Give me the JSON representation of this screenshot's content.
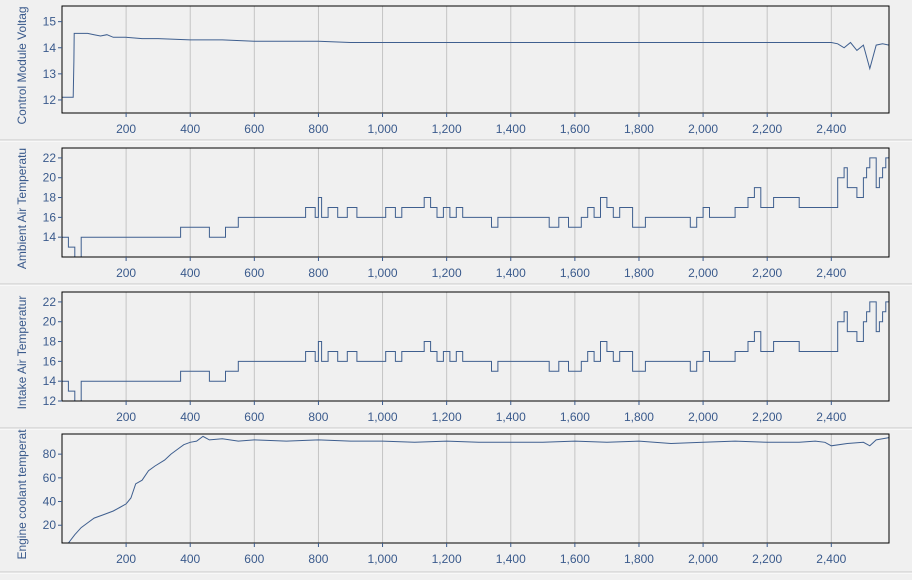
{
  "colors": {
    "line": "#3f5f8f",
    "tick_text": "#3a5a8c",
    "grid": "#c4c4c4",
    "plot_bg": "#f0f0f0",
    "frame": "#000000"
  },
  "chart_data": [
    {
      "type": "line",
      "ylabel": "Control Module Voltag",
      "xlim": [
        0,
        2580
      ],
      "ylim": [
        11.5,
        15.6
      ],
      "yticks": [
        12,
        13,
        14,
        15
      ],
      "xticks": [
        200,
        400,
        600,
        800,
        1000,
        1200,
        1400,
        1600,
        1800,
        2000,
        2200,
        2400
      ],
      "xtick_labels": [
        "200",
        "400",
        "600",
        "800",
        "1,000",
        "1,200",
        "1,400",
        "1,600",
        "1,800",
        "2,000",
        "2,200",
        "2,400"
      ],
      "grid": true,
      "series": [
        {
          "x": [
            0,
            35,
            37,
            38,
            80,
            100,
            120,
            140,
            160,
            200,
            250,
            300,
            400,
            500,
            600,
            700,
            800,
            900,
            1000,
            1100,
            1200,
            1300,
            1400,
            1500,
            1600,
            1700,
            1800,
            1900,
            2000,
            2100,
            2200,
            2300,
            2380,
            2400,
            2420,
            2440,
            2460,
            2480,
            2500,
            2520,
            2540,
            2560,
            2580
          ],
          "y": [
            12.1,
            12.1,
            13.5,
            14.55,
            14.55,
            14.5,
            14.45,
            14.5,
            14.4,
            14.4,
            14.35,
            14.35,
            14.3,
            14.3,
            14.25,
            14.25,
            14.25,
            14.2,
            14.2,
            14.2,
            14.2,
            14.2,
            14.2,
            14.2,
            14.2,
            14.2,
            14.2,
            14.2,
            14.2,
            14.2,
            14.2,
            14.2,
            14.2,
            14.2,
            14.15,
            14.0,
            14.2,
            13.9,
            14.1,
            13.2,
            14.1,
            14.15,
            14.1
          ]
        }
      ]
    },
    {
      "type": "line",
      "ylabel": "Ambient Air Temperatu",
      "xlim": [
        0,
        2580
      ],
      "ylim": [
        12,
        23
      ],
      "yticks": [
        14,
        16,
        18,
        20,
        22
      ],
      "xticks": [
        200,
        400,
        600,
        800,
        1000,
        1200,
        1400,
        1600,
        1800,
        2000,
        2200,
        2400
      ],
      "xtick_labels": [
        "200",
        "400",
        "600",
        "800",
        "1,000",
        "1,200",
        "1,400",
        "1,600",
        "1,800",
        "2,000",
        "2,200",
        "2,400"
      ],
      "grid": true,
      "series": [
        {
          "step": true,
          "x": [
            0,
            20,
            40,
            60,
            340,
            370,
            440,
            460,
            510,
            550,
            730,
            760,
            790,
            800,
            810,
            830,
            850,
            860,
            890,
            920,
            950,
            1010,
            1040,
            1060,
            1110,
            1130,
            1150,
            1170,
            1190,
            1210,
            1230,
            1250,
            1270,
            1290,
            1340,
            1360,
            1370,
            1500,
            1520,
            1550,
            1580,
            1620,
            1640,
            1660,
            1680,
            1700,
            1720,
            1740,
            1780,
            1820,
            1850,
            1960,
            1980,
            2000,
            2020,
            2040,
            2100,
            2140,
            2160,
            2180,
            2200,
            2220,
            2260,
            2300,
            2400,
            2420,
            2440,
            2450,
            2460,
            2480,
            2500,
            2510,
            2520,
            2540,
            2550,
            2560,
            2570,
            2580
          ],
          "y": [
            14,
            13,
            12,
            14,
            14,
            15,
            15,
            14,
            15,
            16,
            16,
            17,
            16,
            18,
            16,
            17,
            17,
            16,
            17,
            16,
            16,
            17,
            16,
            17,
            17,
            18,
            17,
            16,
            17,
            16,
            17,
            16,
            16,
            16,
            15,
            16,
            16,
            16,
            15,
            16,
            15,
            16,
            17,
            16,
            18,
            17,
            16,
            17,
            15,
            16,
            16,
            15,
            16,
            17,
            16,
            16,
            17,
            18,
            19,
            17,
            17,
            18,
            18,
            17,
            17,
            20,
            21,
            19,
            19,
            18,
            20,
            21,
            22,
            19,
            20,
            21,
            22,
            23
          ]
        }
      ]
    },
    {
      "type": "line",
      "ylabel": "Intake Air Temperatur",
      "xlim": [
        0,
        2580
      ],
      "ylim": [
        12,
        23
      ],
      "yticks": [
        12,
        14,
        16,
        18,
        20,
        22
      ],
      "xticks": [
        200,
        400,
        600,
        800,
        1000,
        1200,
        1400,
        1600,
        1800,
        2000,
        2200,
        2400
      ],
      "xtick_labels": [
        "200",
        "400",
        "600",
        "800",
        "1,000",
        "1,200",
        "1,400",
        "1,600",
        "1,800",
        "2,000",
        "2,200",
        "2,400"
      ],
      "grid": true,
      "series": [
        {
          "step": true,
          "x": [
            0,
            20,
            40,
            60,
            340,
            370,
            440,
            460,
            510,
            550,
            730,
            760,
            790,
            800,
            810,
            830,
            850,
            860,
            890,
            920,
            950,
            1010,
            1040,
            1060,
            1110,
            1130,
            1150,
            1170,
            1190,
            1210,
            1230,
            1250,
            1270,
            1290,
            1340,
            1360,
            1370,
            1500,
            1520,
            1550,
            1580,
            1620,
            1640,
            1660,
            1680,
            1700,
            1720,
            1740,
            1780,
            1820,
            1850,
            1960,
            1980,
            2000,
            2020,
            2040,
            2100,
            2140,
            2160,
            2180,
            2200,
            2220,
            2260,
            2300,
            2400,
            2420,
            2440,
            2450,
            2460,
            2480,
            2500,
            2510,
            2520,
            2540,
            2550,
            2560,
            2570,
            2580
          ],
          "y": [
            14,
            13,
            12,
            14,
            14,
            15,
            15,
            14,
            15,
            16,
            16,
            17,
            16,
            18,
            16,
            17,
            17,
            16,
            17,
            16,
            16,
            17,
            16,
            17,
            17,
            18,
            17,
            16,
            17,
            16,
            17,
            16,
            16,
            16,
            15,
            16,
            16,
            16,
            15,
            16,
            15,
            16,
            17,
            16,
            18,
            17,
            16,
            17,
            15,
            16,
            16,
            15,
            16,
            17,
            16,
            16,
            17,
            18,
            19,
            17,
            17,
            18,
            18,
            17,
            17,
            20,
            21,
            19,
            19,
            18,
            20,
            21,
            22,
            19,
            20,
            21,
            22,
            23
          ]
        }
      ]
    },
    {
      "type": "line",
      "ylabel": "Engine coolant temperat",
      "xlim": [
        0,
        2580
      ],
      "ylim": [
        5,
        97
      ],
      "yticks": [
        20,
        40,
        60,
        80
      ],
      "xticks": [
        200,
        400,
        600,
        800,
        1000,
        1200,
        1400,
        1600,
        1800,
        2000,
        2200,
        2400
      ],
      "xtick_labels": [
        "200",
        "400",
        "600",
        "800",
        "1,000",
        "1,200",
        "1,400",
        "1,600",
        "1,800",
        "2,000",
        "2,200",
        "2,400"
      ],
      "grid": true,
      "series": [
        {
          "x": [
            0,
            20,
            40,
            60,
            80,
            100,
            130,
            160,
            180,
            200,
            215,
            230,
            250,
            270,
            290,
            320,
            340,
            360,
            380,
            400,
            420,
            440,
            460,
            500,
            550,
            600,
            700,
            800,
            900,
            1000,
            1100,
            1200,
            1300,
            1400,
            1500,
            1600,
            1700,
            1800,
            1900,
            2000,
            2100,
            2200,
            2300,
            2350,
            2380,
            2400,
            2450,
            2500,
            2520,
            2540,
            2560,
            2580
          ],
          "y": [
            5,
            5,
            12,
            18,
            22,
            26,
            29,
            32,
            35,
            38,
            43,
            55,
            58,
            66,
            70,
            75,
            80,
            84,
            88,
            90,
            91,
            95,
            92,
            93,
            91,
            92,
            91,
            92,
            91,
            91,
            90,
            91,
            90,
            90,
            90,
            91,
            90,
            91,
            89,
            90,
            91,
            90,
            90,
            91,
            90,
            87,
            89,
            90,
            87,
            92,
            93,
            94
          ]
        }
      ]
    }
  ]
}
